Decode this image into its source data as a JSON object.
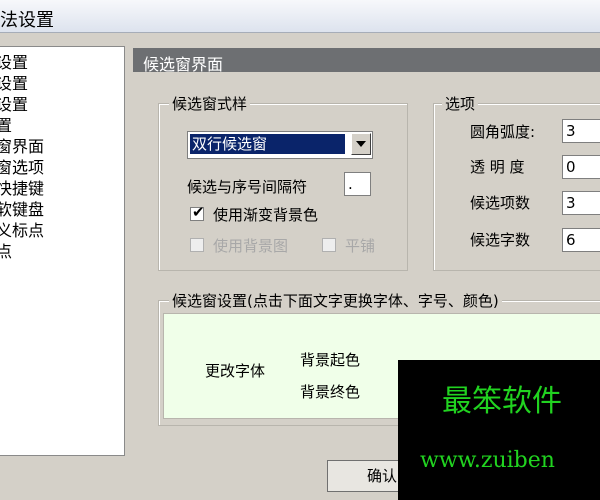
{
  "window": {
    "title": "法设置"
  },
  "tree": {
    "items": [
      "设置",
      "设置",
      "设置",
      "置",
      "窗界面",
      "窗选项",
      "快捷键",
      "软键盘",
      "义标点",
      "点"
    ]
  },
  "section": {
    "title": "候选窗界面"
  },
  "style_group": {
    "title": "候选窗式样",
    "combo_value": "双行候选窗",
    "separator_label": "候选与序号间隔符",
    "separator_value": ".",
    "gradient": {
      "label": "使用渐变背景色",
      "checked": true
    },
    "bgimage": {
      "label": "使用背景图",
      "checked": false,
      "enabled": false
    },
    "tile": {
      "label": "平铺",
      "checked": false,
      "enabled": false
    }
  },
  "options_group": {
    "title": "选项",
    "fields": [
      {
        "label": "圆角弧度:",
        "value": "3"
      },
      {
        "label": "透 明 度",
        "value": "0"
      },
      {
        "label": "候选项数",
        "value": "3"
      },
      {
        "label": "候选字数",
        "value": "6"
      }
    ]
  },
  "settings_group": {
    "title": "候选窗设置(点击下面文字更换字体、字号、颜色)",
    "change_font": "更改字体",
    "bg_start": "背景起色",
    "bg_end": "背景终色"
  },
  "buttons": {
    "ok": "确认"
  },
  "watermark": {
    "line1": "最笨软件",
    "line2": "www.zuiben"
  },
  "colors": {
    "header_bg": "#6d6f72",
    "preview_bg": "#f0ffe9",
    "selection": "#0a246a",
    "watermark_text": "#21d320"
  }
}
